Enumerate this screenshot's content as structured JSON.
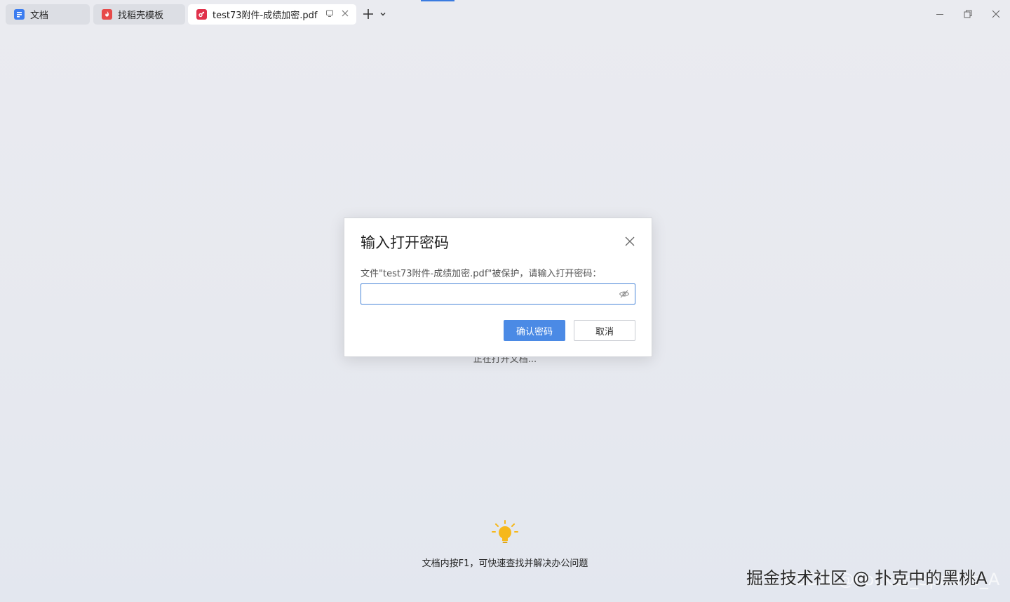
{
  "tabs": [
    {
      "label": "文档",
      "icon": "doc-icon",
      "color": "#3b7cf0",
      "active": false
    },
    {
      "label": "找稻壳模板",
      "icon": "docer-icon",
      "color": "#e74a4a",
      "active": false
    },
    {
      "label": "test73附件-成绩加密.pdf",
      "icon": "pdf-icon",
      "color": "#e0314b",
      "active": true
    }
  ],
  "loading_text": "正在打开文档...",
  "dialog": {
    "title": "输入打开密码",
    "description": "文件\"test73附件-成绩加密.pdf\"被保护，请输入打开密码：",
    "password_value": "",
    "confirm_label": "确认密码",
    "cancel_label": "取消"
  },
  "tip": {
    "text": "文档内按F1，可快速查找并解决办公问题"
  },
  "watermark": {
    "main": "掘金技术社区 @ 扑克中的黑桃A",
    "secondary": "CSDN @Pocker_Spades_A"
  },
  "colors": {
    "accent": "#4b8ae5",
    "pdf_red": "#e0314b",
    "bulb": "#f6b81b"
  }
}
